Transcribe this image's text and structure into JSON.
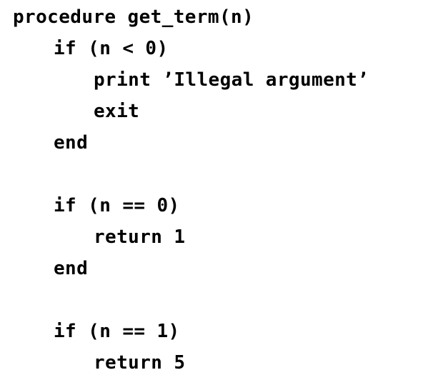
{
  "code": {
    "lines": [
      "procedure get_term(n)",
      "if (n < 0)",
      "print ’Illegal argument’",
      "exit",
      "end",
      "",
      "if (n == 0)",
      "return 1",
      "end",
      "",
      "if (n == 1)",
      "return 5"
    ]
  }
}
